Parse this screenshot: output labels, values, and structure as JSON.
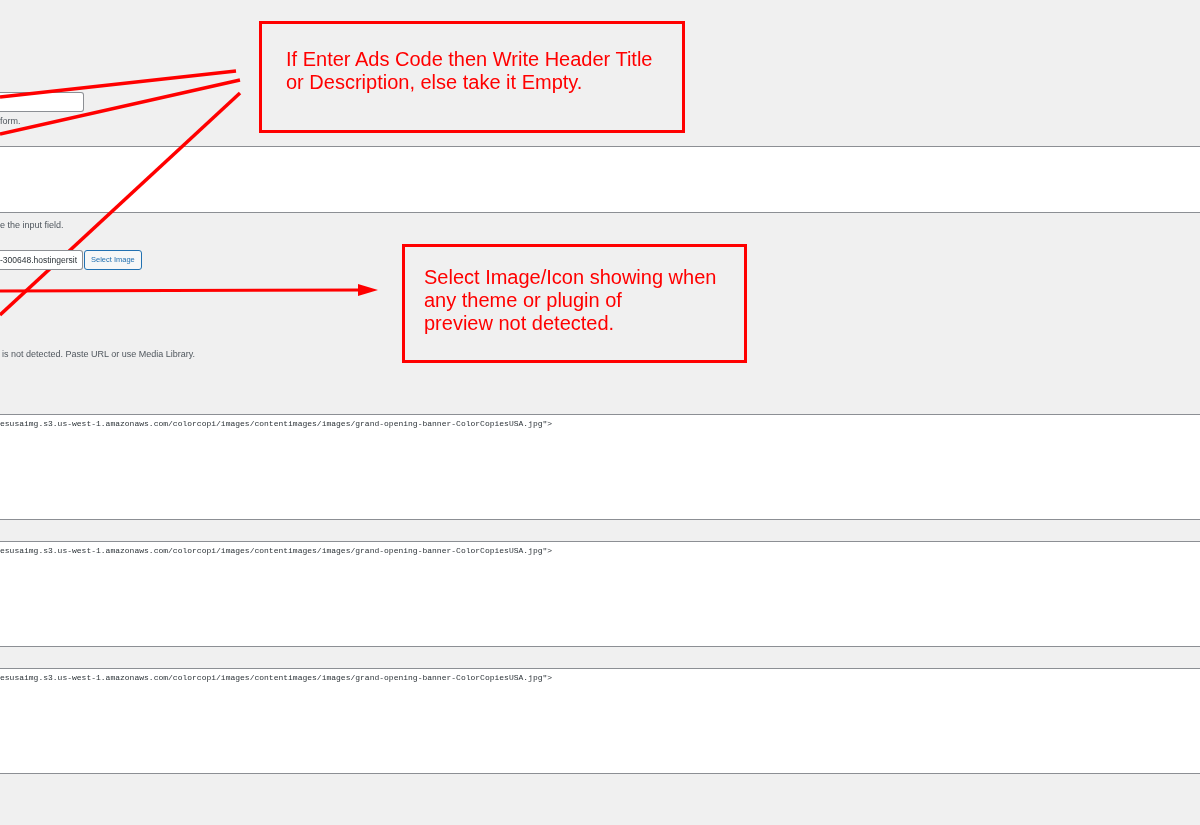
{
  "annotations": [
    {
      "lines": [
        "If Enter Ads Code then Write Header Title",
        "or Description, else take it Empty."
      ]
    },
    {
      "lines": [
        "Select Image/Icon showing when",
        "any theme or plugin of",
        "preview not detected."
      ]
    }
  ],
  "form": [
    {
      "kind": "input",
      "hint": "form."
    },
    {
      "kind": "textarea"
    },
    {
      "kind": "image_picker",
      "note": "e the input field.",
      "value": "-300648.hostingersit",
      "button": "Select Image",
      "hint": "is not detected. Paste URL or use Media Library."
    },
    {
      "kind": "code",
      "value": "esusaimg.s3.us-west-1.amazonaws.com/colorcopi/images/contentimages/images/grand-opening-banner-ColorCopiesUSA.jpg\">"
    },
    {
      "kind": "code",
      "value": "esusaimg.s3.us-west-1.amazonaws.com/colorcopi/images/contentimages/images/grand-opening-banner-ColorCopiesUSA.jpg\">"
    },
    {
      "kind": "code",
      "value": "esusaimg.s3.us-west-1.amazonaws.com/colorcopi/images/contentimages/images/grand-opening-banner-ColorCopiesUSA.jpg\">"
    }
  ]
}
